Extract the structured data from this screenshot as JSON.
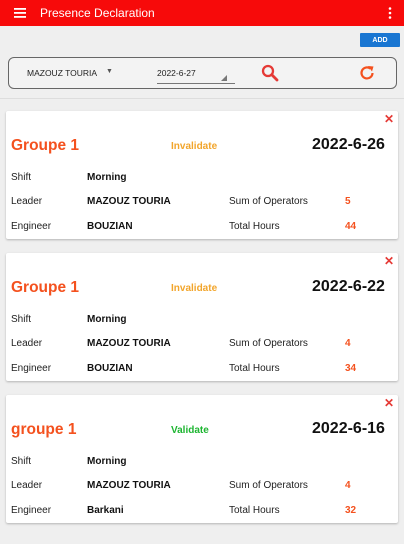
{
  "appbar": {
    "menu_icon": "hamburger-menu-icon",
    "title": "Presence Declaration",
    "more_icon": "more-vert-icon",
    "color": "#f70a0a"
  },
  "add_button": {
    "label": "ADD",
    "color": "#1976d2"
  },
  "filter": {
    "leader_value": "MAZOUZ TOURIA",
    "date_value": "2022-6-27",
    "search_icon": "search-icon",
    "refresh_icon": "refresh-icon"
  },
  "labels": {
    "shift": "Shift",
    "leader": "Leader",
    "engineer": "Engineer",
    "sum_operators": "Sum of Operators",
    "total_hours": "Total Hours"
  },
  "colors": {
    "invalidate": "#f2a52b",
    "validate": "#1db531",
    "accent": "#f4511e"
  },
  "cards": [
    {
      "group": "Groupe 1",
      "status": "Invalidate",
      "date": "2022-6-26",
      "shift": "Morning",
      "leader": "MAZOUZ TOURIA",
      "engineer": "BOUZIAN",
      "sum_operators": "5",
      "total_hours": "44"
    },
    {
      "group": "Groupe 1",
      "status": "Invalidate",
      "date": "2022-6-22",
      "shift": "Morning",
      "leader": "MAZOUZ TOURIA",
      "engineer": "BOUZIAN",
      "sum_operators": "4",
      "total_hours": "34"
    },
    {
      "group": "groupe 1",
      "status": "Validate",
      "date": "2022-6-16",
      "shift": "Morning",
      "leader": "MAZOUZ TOURIA",
      "engineer": "Barkani",
      "sum_operators": "4",
      "total_hours": "32"
    }
  ]
}
